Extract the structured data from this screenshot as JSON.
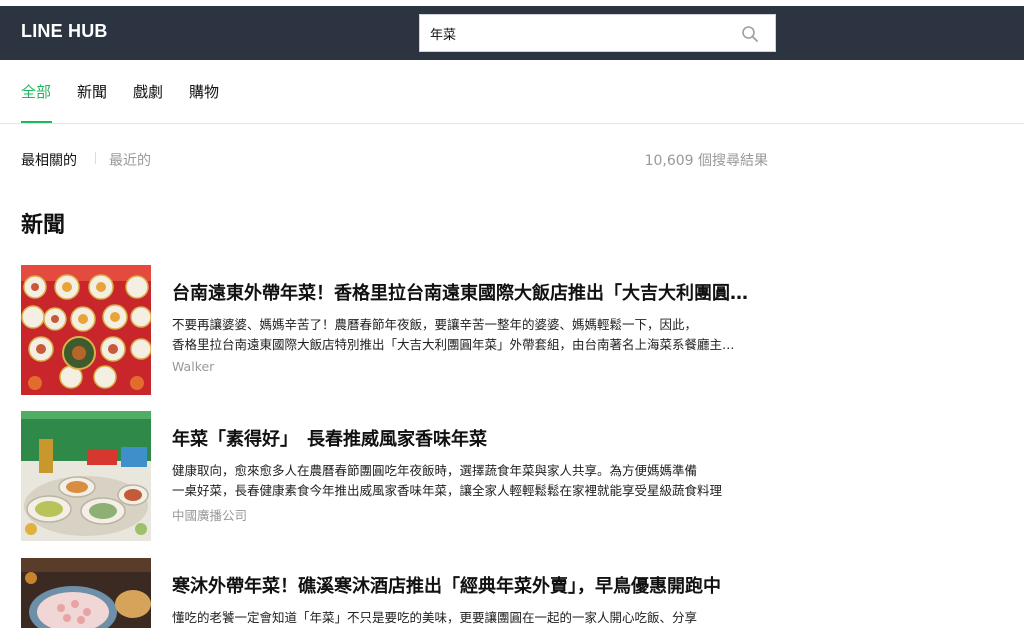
{
  "header": {
    "logo": "LINE HUB",
    "search": {
      "value": "年菜",
      "icon": "search-icon"
    }
  },
  "tabs": [
    {
      "label": "全部",
      "active": true
    },
    {
      "label": "新聞",
      "active": false
    },
    {
      "label": "戲劇",
      "active": false
    },
    {
      "label": "購物",
      "active": false
    }
  ],
  "sort": {
    "relevant": "最相關的",
    "recent": "最近的",
    "result_count": "10,609 個搜尋結果"
  },
  "section_title": "新聞",
  "articles": [
    {
      "title": "台南遠東外帶年菜！香格里拉台南遠東國際大飯店推出「大吉大利團圓年菜」外帶套組",
      "desc_line1": "不要再讓婆婆、媽媽辛苦了！農曆春節年夜飯，要讓辛苦一整年的婆婆、媽媽輕鬆一下，因此，",
      "desc_line2": "香格里拉台南遠東國際大飯店特別推出「大吉大利團圓年菜」外帶套組，由台南著名上海菜系餐廳主廚精心打造",
      "source": "Walker"
    },
    {
      "title": "年菜「素得好」　長春推威風家香味年菜",
      "desc_line1": "健康取向，愈來愈多人在農曆春節團圓吃年夜飯時，選擇蔬食年菜與家人共享。為方便媽媽準備",
      "desc_line2": "一桌好菜，長春健康素食今年推出威風家香味年菜，讓全家人輕輕鬆鬆在家裡就能享受星級蔬食料理",
      "source": "中國廣播公司"
    },
    {
      "title": "寒沐外帶年菜！礁溪寒沐酒店推出「經典年菜外賣」，早鳥優惠開跑中",
      "desc_line1": "懂吃的老饕一定會知道「年菜」不只是要吃的美味，更要讓團圓在一起的一家人開心吃飯、分享",
      "desc_line2": "",
      "source": ""
    }
  ],
  "colors": {
    "header_bg": "#2b3440",
    "accent": "#1fb75e",
    "muted": "#999999"
  }
}
